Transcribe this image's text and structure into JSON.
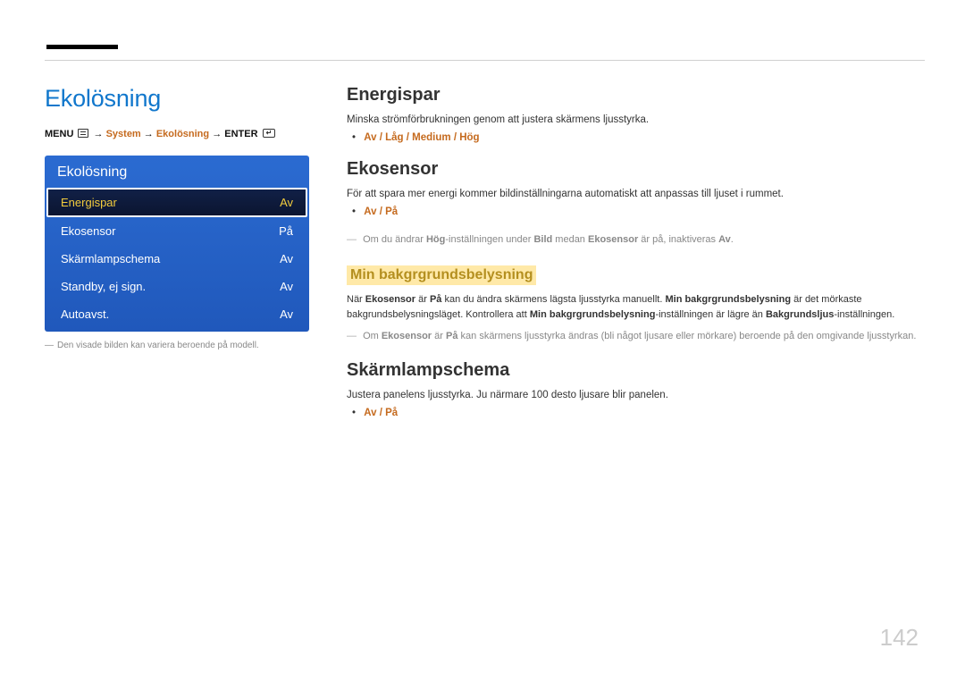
{
  "page_number": "142",
  "main_title": "Ekolösning",
  "breadcrumb": {
    "menu_label": "MENU",
    "seg1": "System",
    "seg2": "Ekolösning",
    "enter_label": "ENTER",
    "arrow": "→"
  },
  "menu_panel": {
    "title": "Ekolösning",
    "items": [
      {
        "label": "Energispar",
        "value": "Av",
        "selected": true
      },
      {
        "label": "Ekosensor",
        "value": "På",
        "selected": false
      },
      {
        "label": "Skärmlampschema",
        "value": "Av",
        "selected": false
      },
      {
        "label": "Standby, ej sign.",
        "value": "Av",
        "selected": false
      },
      {
        "label": "Autoavst.",
        "value": "Av",
        "selected": false
      }
    ],
    "note": "Den visade bilden kan variera beroende på modell."
  },
  "sections": {
    "energispar": {
      "heading": "Energispar",
      "desc": "Minska strömförbrukningen genom att justera skärmens ljusstyrka.",
      "options": [
        "Av",
        "Låg",
        "Medium",
        "Hög"
      ]
    },
    "ekosensor": {
      "heading": "Ekosensor",
      "desc": "För att spara mer energi kommer bildinställningarna automatiskt att anpassas till ljuset i rummet.",
      "options": [
        "Av",
        "På"
      ],
      "note_parts": {
        "p1": "Om du ändrar ",
        "b1": "Hög",
        "p2": "-inställningen under ",
        "b2": "Bild",
        "p3": " medan ",
        "b3": "Ekosensor",
        "p4": " är på, inaktiveras ",
        "b4": "Av",
        "p5": "."
      },
      "sub": {
        "heading": "Min bakgrgrundsbelysning",
        "para_parts": {
          "p1": "När ",
          "b1": "Ekosensor",
          "p2": " är ",
          "b2": "På",
          "p3": " kan du ändra skärmens lägsta ljusstyrka manuellt. ",
          "b3": "Min bakgrgrundsbelysning",
          "p4": " är det mörkaste bakgrundsbelysningsläget. Kontrollera att ",
          "b4": "Min bakgrgrundsbelysning",
          "p5": "-inställningen är lägre än ",
          "b5": "Bakgrundsljus",
          "p6": "-inställningen."
        },
        "note_parts": {
          "p1": "Om ",
          "b1": "Ekosensor",
          "p2": " är ",
          "b2": "På",
          "p3": " kan skärmens ljusstyrka ändras (bli något ljusare eller mörkare) beroende på den omgivande ljusstyrkan."
        }
      }
    },
    "skarmlampschema": {
      "heading": "Skärmlampschema",
      "desc": "Justera panelens ljusstyrka. Ju närmare 100 desto ljusare blir panelen.",
      "options": [
        "Av",
        "På"
      ]
    }
  }
}
